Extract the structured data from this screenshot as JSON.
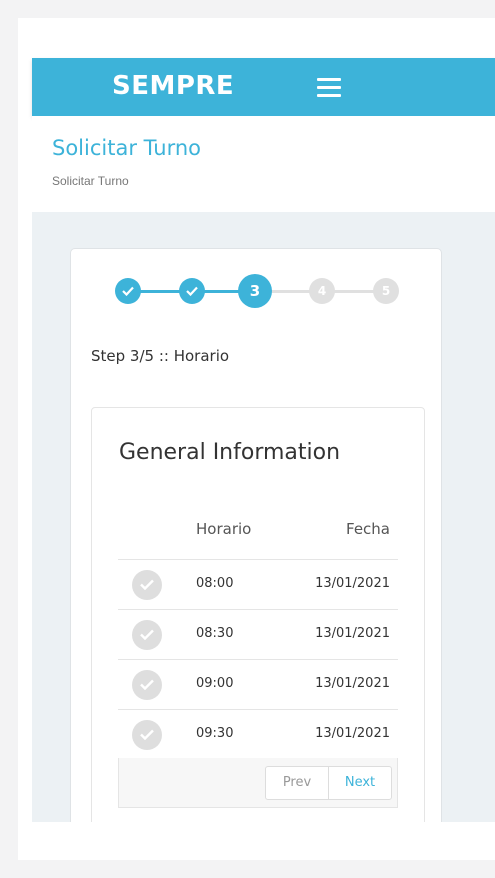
{
  "header": {
    "brand": "SEMPRE"
  },
  "page": {
    "title": "Solicitar Turno",
    "breadcrumb": "Solicitar Turno"
  },
  "stepper": {
    "steps": [
      "1",
      "2",
      "3",
      "4",
      "5"
    ],
    "current": 3,
    "label": "Step 3/5 :: Horario"
  },
  "card": {
    "title": "General Information",
    "columns": [
      "Horario",
      "Fecha"
    ],
    "rows": [
      {
        "horario": "08:00",
        "fecha": "13/01/2021"
      },
      {
        "horario": "08:30",
        "fecha": "13/01/2021"
      },
      {
        "horario": "09:00",
        "fecha": "13/01/2021"
      },
      {
        "horario": "09:30",
        "fecha": "13/01/2021"
      }
    ],
    "pager": {
      "prev": "Prev",
      "next": "Next"
    }
  },
  "colors": {
    "accent": "#3db3d9",
    "inactive": "#e0e0e0",
    "background": "#ecf1f4"
  }
}
